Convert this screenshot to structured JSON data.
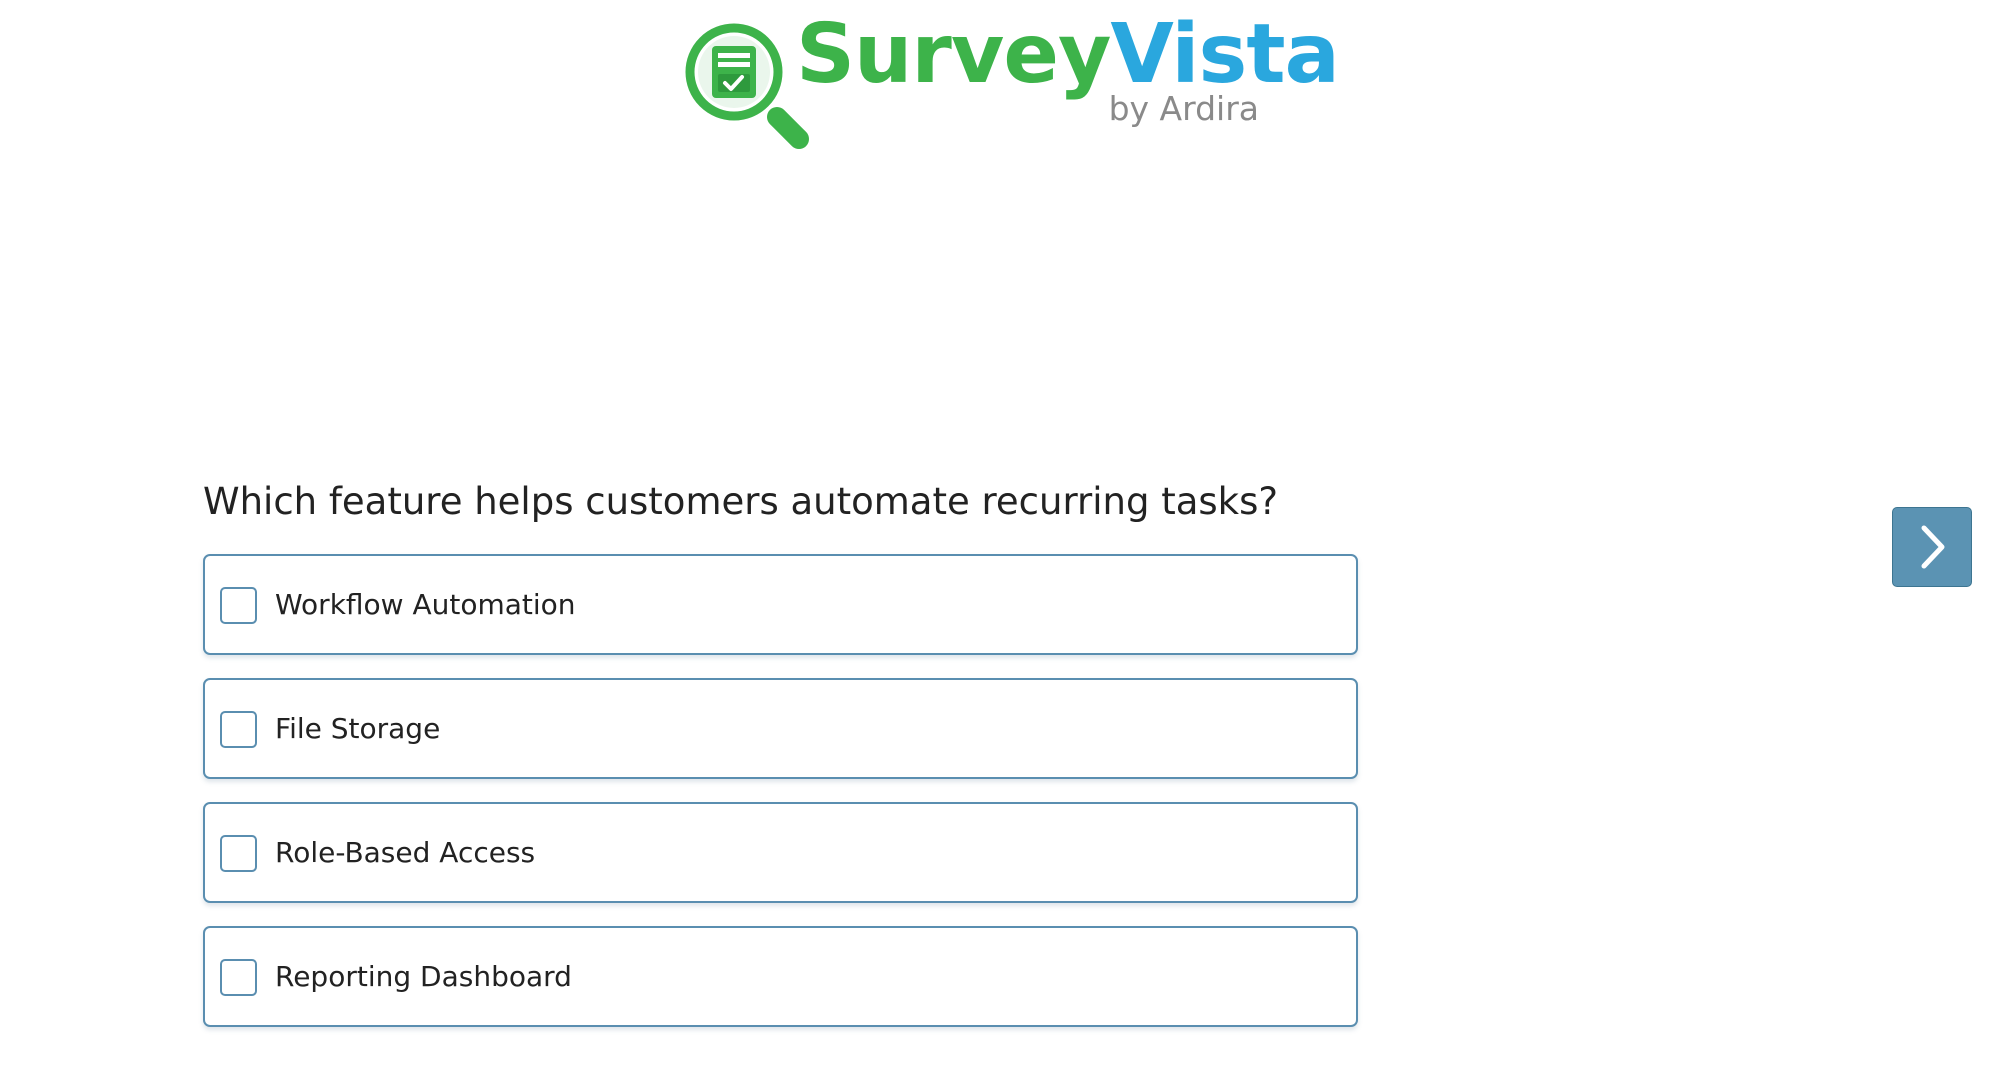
{
  "logo": {
    "word_part1": "Survey",
    "word_part2": "Vista",
    "subtitle": "by Ardira",
    "icon": "magnifier-survey-icon"
  },
  "colors": {
    "logo_green": "#3db34a",
    "logo_blue": "#2aa7de",
    "logo_gray": "#8a8a8a",
    "option_border": "#5a8eb0",
    "nav_blue": "#5b93b3"
  },
  "question": {
    "text": "Which feature helps customers automate recurring tasks?",
    "options": [
      {
        "label": "Workflow Automation",
        "checked": false
      },
      {
        "label": "File Storage",
        "checked": false
      },
      {
        "label": "Role-Based Access",
        "checked": false
      },
      {
        "label": "Reporting Dashboard",
        "checked": false
      }
    ]
  },
  "navigation": {
    "next_icon": "chevron-right-icon"
  }
}
